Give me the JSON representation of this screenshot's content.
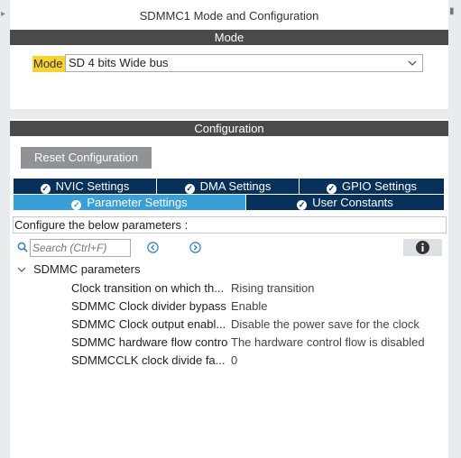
{
  "window": {
    "title": "SDMMC1 Mode and Configuration"
  },
  "mode_section": {
    "header": "Mode",
    "mode_label": "Mode",
    "mode_value": "SD 4 bits Wide bus"
  },
  "config_section": {
    "header": "Configuration",
    "reset_label": "Reset Configuration",
    "tabs": [
      {
        "label": "NVIC Settings",
        "active": false
      },
      {
        "label": "DMA Settings",
        "active": false
      },
      {
        "label": "GPIO Settings",
        "active": false
      },
      {
        "label": "Parameter Settings",
        "active": true
      },
      {
        "label": "User Constants",
        "active": false
      }
    ],
    "description": "Configure the below parameters :",
    "search_placeholder": "Search (Ctrl+F)",
    "group": {
      "label": "SDMMC parameters",
      "params": [
        {
          "name": "Clock transition on which th...",
          "value": "Rising transition"
        },
        {
          "name": "SDMMC Clock divider bypass",
          "value": "Enable"
        },
        {
          "name": "SDMMC Clock output enabl...",
          "value": "Disable the power save for the clock"
        },
        {
          "name": "SDMMC hardware flow control",
          "value": "The hardware control flow is disabled"
        },
        {
          "name": "SDMMCCLK clock divide fa...",
          "value": "0"
        }
      ]
    }
  },
  "colors": {
    "header_bar": "#4a4a4a",
    "tab_bg": "#07305b",
    "tab_active": "#3a9fd6",
    "mode_highlight": "#f6d331",
    "reset_button": "#8f9296"
  }
}
